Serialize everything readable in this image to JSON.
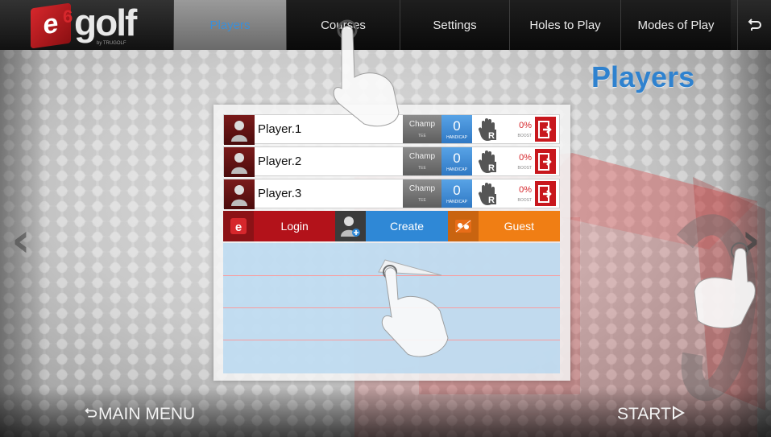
{
  "topbar": {
    "logo": {
      "brand": "e6golf",
      "sub": "by TRUGOLF"
    },
    "tabs": [
      {
        "label": "Players",
        "active": true
      },
      {
        "label": "Courses",
        "active": false
      },
      {
        "label": "Settings",
        "active": false
      },
      {
        "label": "Holes to Play",
        "active": false
      },
      {
        "label": "Modes of Play",
        "active": false
      }
    ],
    "back_icon": "return-icon"
  },
  "page_title": "Players",
  "players": [
    {
      "name": "Player.1",
      "tee": "Champ",
      "tee_sub": "TEE",
      "handicap": "0",
      "handicap_sub": "HANDICAP",
      "hand": "R",
      "boost": "0%",
      "boost_sub": "BOOST"
    },
    {
      "name": "Player.2",
      "tee": "Champ",
      "tee_sub": "TEE",
      "handicap": "0",
      "handicap_sub": "HANDICAP",
      "hand": "R",
      "boost": "0%",
      "boost_sub": "BOOST"
    },
    {
      "name": "Player.3",
      "tee": "Champ",
      "tee_sub": "TEE",
      "handicap": "0",
      "handicap_sub": "HANDICAP",
      "hand": "R",
      "boost": "0%",
      "boost_sub": "BOOST"
    }
  ],
  "actions": {
    "login": "Login",
    "create": "Create",
    "guest": "Guest"
  },
  "footer": {
    "main_menu": "MAIN MENU",
    "start": "START"
  },
  "colors": {
    "accent_blue": "#2f82cf",
    "brand_red": "#c8171d",
    "login_bg": "#b3121a",
    "create_bg": "#2f88d6",
    "guest_bg": "#f07e14"
  }
}
